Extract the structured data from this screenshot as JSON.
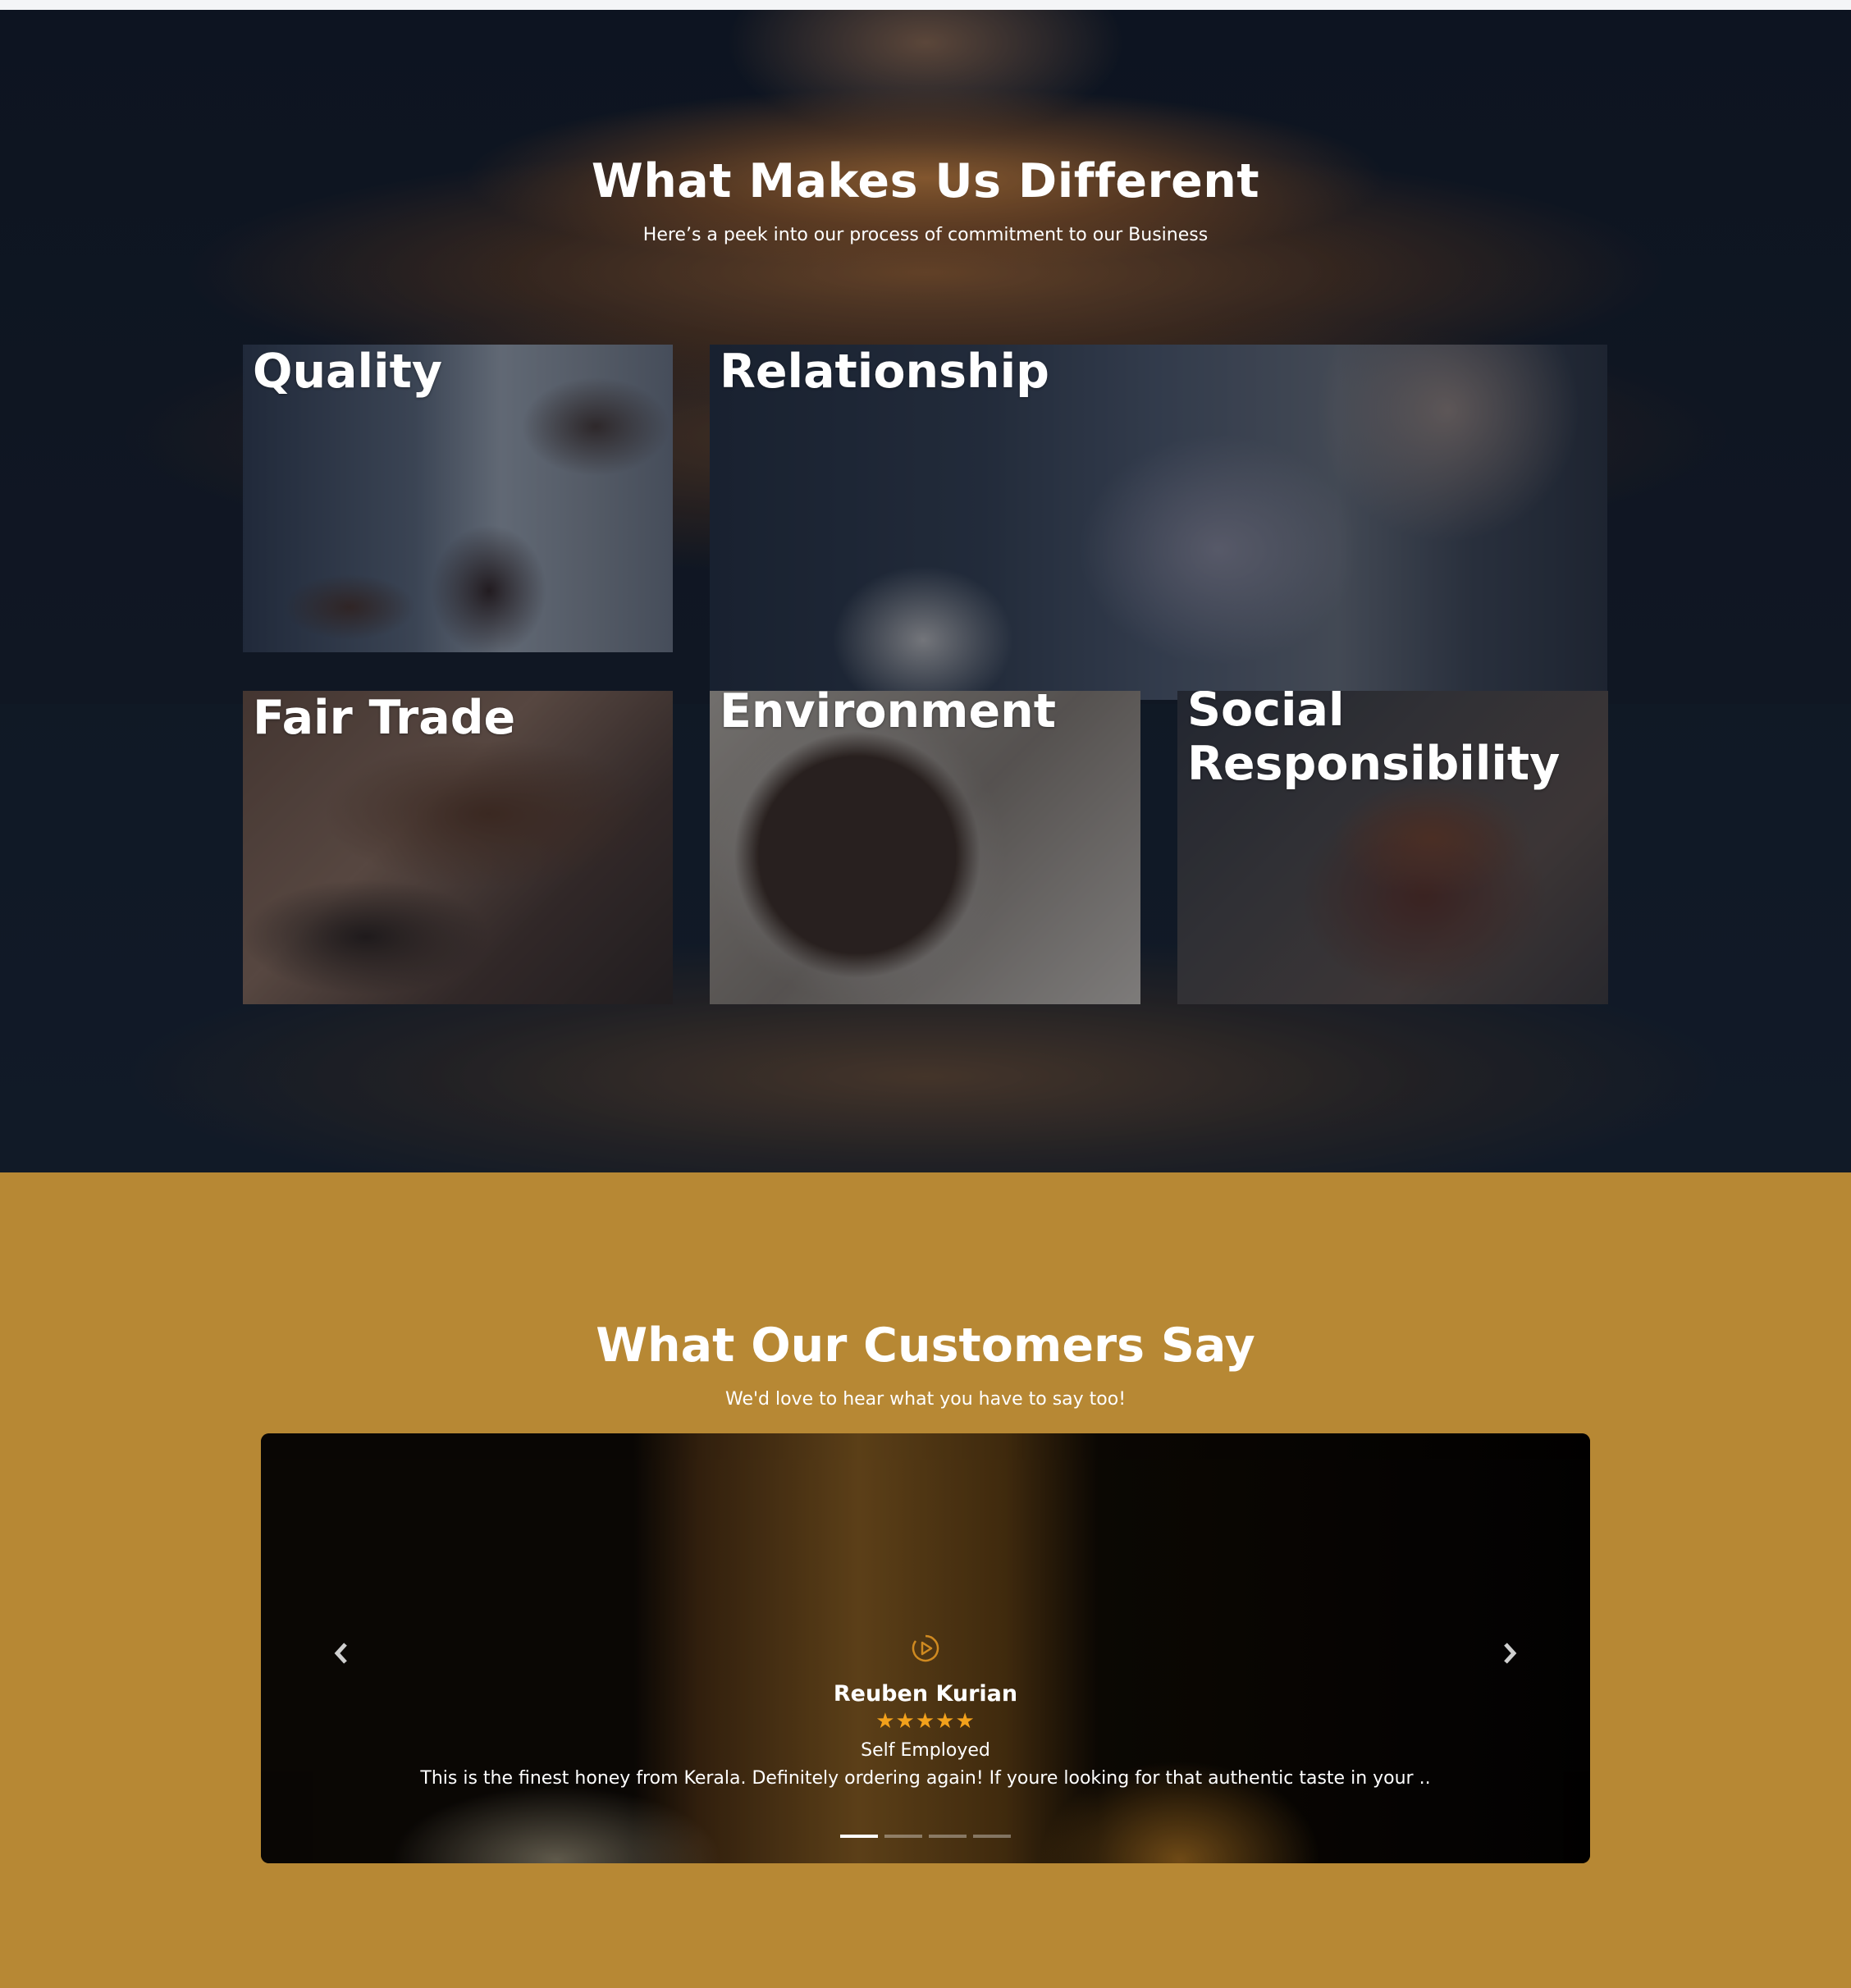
{
  "different": {
    "title": "What Makes Us Different",
    "subtitle": "Here’s a peek into our process of commitment to our Business",
    "cards": [
      {
        "label": "Quality"
      },
      {
        "label": "Relationship"
      },
      {
        "label": "Fair Trade"
      },
      {
        "label": "Environment"
      },
      {
        "label": "Social Responsibility"
      }
    ]
  },
  "testimonials": {
    "title": "What Our Customers Say",
    "subtitle": "We'd love to hear what you have to say too!",
    "current": {
      "name": "Reuben Kurian",
      "stars": "★★★★★",
      "rating": 5,
      "role": "Self Employed",
      "text": "This is the finest honey from Kerala. Definitely ordering again! If youre looking for that authentic taste in your .."
    },
    "slide_count": 4,
    "active_slide": 1
  },
  "colors": {
    "testimonial_bg": "#b78834",
    "star": "#f2a11b",
    "play_icon": "#d08a20"
  }
}
